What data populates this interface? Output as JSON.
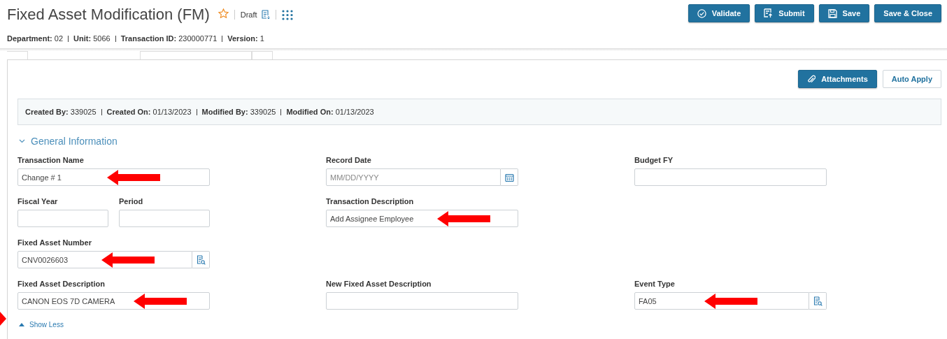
{
  "header": {
    "title": "Fixed Asset Modification (FM)",
    "starred": false,
    "status": "Draft"
  },
  "actions": [
    {
      "label": "Validate"
    },
    {
      "label": "Submit"
    },
    {
      "label": "Save"
    },
    {
      "label": "Save & Close"
    }
  ],
  "meta": [
    {
      "label": "Department:",
      "value": "02"
    },
    {
      "label": "Unit:",
      "value": "5066"
    },
    {
      "label": "Transaction ID:",
      "value": "230000771"
    },
    {
      "label": "Version:",
      "value": "1"
    }
  ],
  "panel_actions": [
    {
      "label": "Attachments",
      "kind": "primary"
    },
    {
      "label": "Auto Apply",
      "kind": "secondary"
    }
  ],
  "audit": [
    {
      "label": "Created By:",
      "value": "339025"
    },
    {
      "label": "Created On:",
      "value": "01/13/2023"
    },
    {
      "label": "Modified By:",
      "value": "339025"
    },
    {
      "label": "Modified On:",
      "value": "01/13/2023"
    }
  ],
  "section": {
    "title": "General Information",
    "expanded": true
  },
  "rows": [
    {
      "cells": [
        [
          {
            "label": "Transaction Name",
            "kind": "text",
            "value": "Change # 1",
            "annotated": true
          }
        ],
        [
          {
            "label": "Record Date",
            "kind": "date",
            "placeholder": "MM/DD/YYYY",
            "annotated": false
          }
        ],
        [
          {
            "label": "Budget FY",
            "kind": "text",
            "annotated": false
          }
        ]
      ]
    },
    {
      "cells": [
        [
          {
            "label": "Fiscal Year",
            "kind": "text",
            "annotated": false
          },
          {
            "label": "Period",
            "kind": "text",
            "annotated": false
          }
        ],
        [
          {
            "label": "Transaction Description",
            "kind": "text",
            "value": "Add Assignee Employee",
            "annotated": true
          }
        ],
        []
      ]
    },
    {
      "cells": [
        [
          {
            "label": "Fixed Asset Number",
            "kind": "lookup",
            "value": "CNV0026603",
            "annotated": true
          }
        ],
        [],
        []
      ]
    },
    {
      "cells": [
        [
          {
            "label": "Fixed Asset Description",
            "kind": "text",
            "value": "CANON EOS 7D CAMERA",
            "annotated": true
          }
        ],
        [
          {
            "label": "New Fixed Asset Description",
            "kind": "text",
            "annotated": false
          }
        ],
        [
          {
            "label": "Event Type",
            "kind": "lookup",
            "value": "FA05",
            "annotated": true
          }
        ]
      ]
    }
  ],
  "toggle": {
    "label": "Show Less",
    "expanded": true,
    "annotated": true
  }
}
